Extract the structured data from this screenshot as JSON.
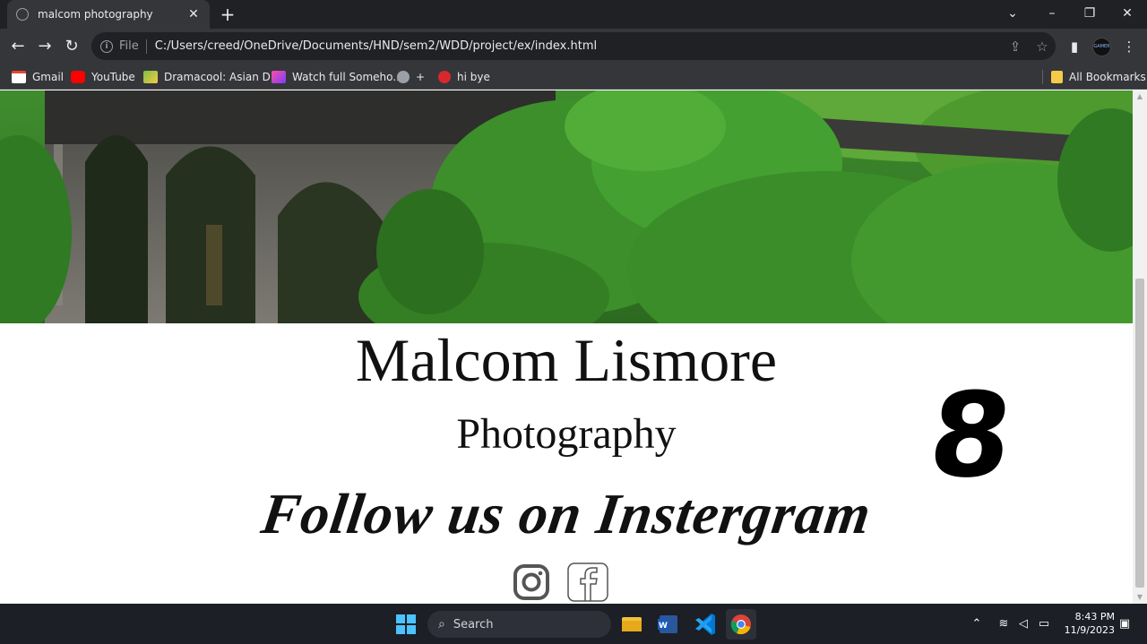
{
  "browser": {
    "tab_title": "malcom photography",
    "address_scheme": "File",
    "address_url": "C:/Users/creed/OneDrive/Documents/HND/sem2/WDD/project/ex/index.html",
    "bookmarks": [
      {
        "label": "Gmail",
        "icon": "gmail-icon",
        "color": "#ea4335"
      },
      {
        "label": "YouTube",
        "icon": "youtube-icon",
        "color": "#ff0000"
      },
      {
        "label": "Dramacool: Asian D...",
        "icon": "dramacool-icon",
        "color": "#7bc043"
      },
      {
        "label": "Watch full Someho...",
        "icon": "kisskh-icon",
        "color": "#b040ff"
      },
      {
        "label": "+",
        "icon": "globe-icon",
        "color": "#9aa0a6"
      },
      {
        "label": "hi bye",
        "icon": "mega-icon",
        "color": "#d9272e"
      }
    ],
    "all_bookmarks": "All Bookmarks"
  },
  "page": {
    "title": "Malcom Lismore",
    "subtitle": "Photography",
    "follow": "Follow us on Instergram",
    "big_digit": "8",
    "social": [
      "instagram-icon",
      "facebook-icon"
    ]
  },
  "taskbar": {
    "search_placeholder": "Search",
    "time": "8:43 PM",
    "date": "11/9/2023"
  }
}
